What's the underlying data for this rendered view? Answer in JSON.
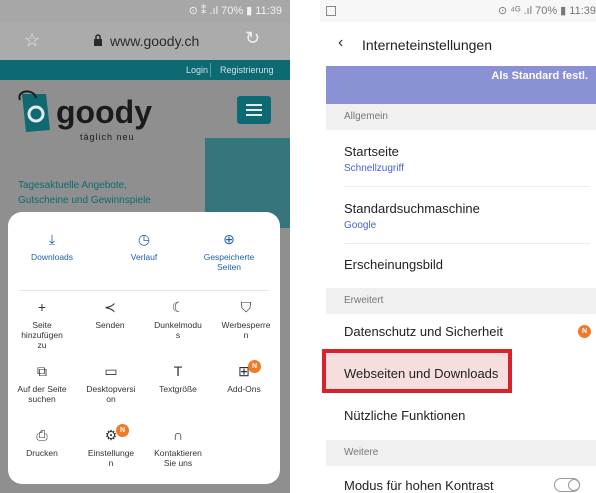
{
  "left": {
    "status": "⊙ ⁑ .ıl 70% ▮ 11:39",
    "url": "www.goody.ch",
    "site": {
      "login": "Login",
      "register": "Registrierung",
      "logo": "goody",
      "tagline": "täglich neu",
      "promo_line1": "Tagesaktuelle Angebote,",
      "promo_line2": "Gutscheine und Gewinnspiele"
    },
    "menu": {
      "top": [
        {
          "label": "Downloads",
          "icon": "download-icon"
        },
        {
          "label": "Verlauf",
          "icon": "clock-icon"
        },
        {
          "label_l1": "Gespeicherte",
          "label_l2": "Seiten",
          "icon": "saved-pages-icon"
        }
      ],
      "row1": [
        {
          "l1": "Seite",
          "l2": "hinzufügen",
          "l3": "zu",
          "icon": "plus-icon"
        },
        {
          "l1": "Senden",
          "icon": "share-icon"
        },
        {
          "l1": "Dunkelmodu",
          "l2": "s",
          "icon": "moon-icon"
        },
        {
          "l1": "Werbesperre",
          "l2": "n",
          "icon": "shield-icon"
        }
      ],
      "row2": [
        {
          "l1": "Auf der Seite",
          "l2": "suchen",
          "icon": "find-on-page-icon"
        },
        {
          "l1": "Desktopversi",
          "l2": "on",
          "icon": "desktop-icon"
        },
        {
          "l1": "Textgröße",
          "icon": "text-size-icon"
        },
        {
          "l1": "Add-Ons",
          "icon": "addons-icon",
          "badge": "N"
        }
      ],
      "row3": [
        {
          "l1": "Drucken",
          "icon": "print-icon"
        },
        {
          "l1": "Einstellunge",
          "l2": "n",
          "icon": "gear-icon",
          "badge": "N"
        },
        {
          "l1": "Kontaktieren",
          "l2": "Sie uns",
          "icon": "headset-icon"
        }
      ]
    }
  },
  "right": {
    "status": "⊙ ⁴ᴳ .ıl 70% ▮ 11:39",
    "title": "Interneteinstellungen",
    "banner_button": "Als Standard festl.",
    "sections": {
      "general": "Allgemein",
      "advanced": "Erweitert",
      "more": "Weitere"
    },
    "rows": {
      "home_title": "Startseite",
      "home_sub": "Schnellzugriff",
      "search_title": "Standardsuchmaschine",
      "search_sub": "Google",
      "appearance": "Erscheinungsbild",
      "privacy": "Datenschutz und Sicherheit",
      "privacy_badge": "N",
      "sites_downloads": "Webseiten und Downloads",
      "useful": "Nützliche Funktionen",
      "contrast": "Modus für hohen Kontrast"
    }
  },
  "colors": {
    "brand_teal": "#0e6a72",
    "accent_blue": "#1f5fae",
    "highlight_red": "#d9232c",
    "badge_orange": "#ef7a27",
    "banner_purple": "#8a90d4"
  }
}
